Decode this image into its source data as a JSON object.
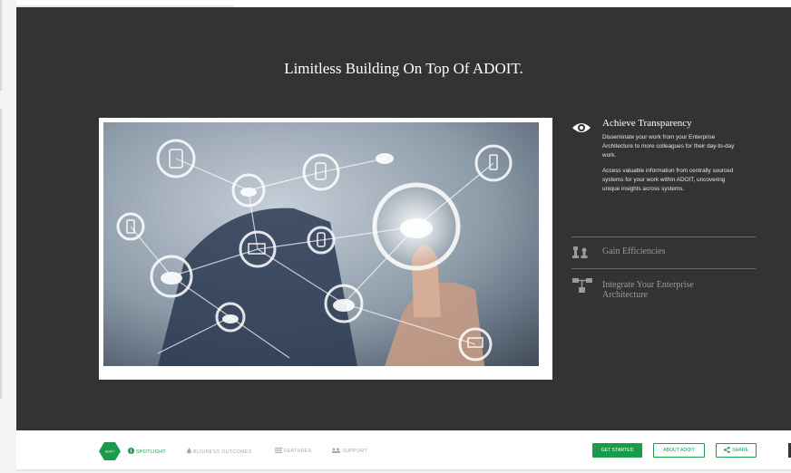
{
  "headline": "Limitless Building On Top Of ADOIT.",
  "features": {
    "active": {
      "icon": "eye-icon",
      "title": "Achieve Transparency",
      "paragraph_1": "Disseminate your work from your Enterprise Architecture to more colleagues for their day-to-day work.",
      "paragraph_2": "Access valuable information from centrally sourced systems for your work within ADOIT, uncovering unique insights across systems."
    },
    "second": {
      "icon": "chess-pieces-icon",
      "title": "Gain Efficiencies"
    },
    "third": {
      "icon": "hierarchy-icon",
      "title": "Integrate Your Enterprise Architecture"
    }
  },
  "footer": {
    "logo_text": "ADOIT",
    "nav": [
      {
        "label": "SPOTLIGHT",
        "icon": "circle-info-icon",
        "active": true
      },
      {
        "label": "BUSINESS OUTCOMES",
        "icon": "drop-icon",
        "active": false
      },
      {
        "label": "FEATURES",
        "icon": "list-icon",
        "active": false
      },
      {
        "label": "SUPPORT",
        "icon": "users-icon",
        "active": false
      }
    ],
    "buttons": {
      "get_started": "GET STARTED",
      "about": "ABOUT ADOIT",
      "share": "SHARE",
      "share_icon": "share-icon"
    }
  },
  "colors": {
    "stage": "#333333",
    "accent": "#1a9b4a",
    "text_muted": "#9a9a9a"
  }
}
